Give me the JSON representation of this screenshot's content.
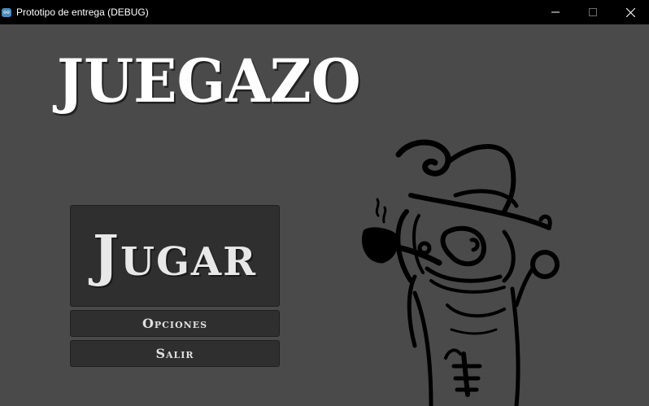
{
  "window": {
    "title": "Prototipo de entrega (DEBUG)",
    "app_icon": "godot-icon",
    "controls": [
      "minimize-icon",
      "maximize-icon",
      "close-icon"
    ]
  },
  "menu": {
    "game_title": "JUEGAZO",
    "play_label": "Jugar",
    "options_label": "Opciones",
    "exit_label": "Salir"
  },
  "illustration": {
    "subject": "cowboy-with-pipe",
    "style": "black-ink-doodle"
  },
  "colors": {
    "background": "#4a4a4a",
    "titlebar": "#000000",
    "button_bg": "#2f2f2f",
    "text": "#ffffff"
  }
}
